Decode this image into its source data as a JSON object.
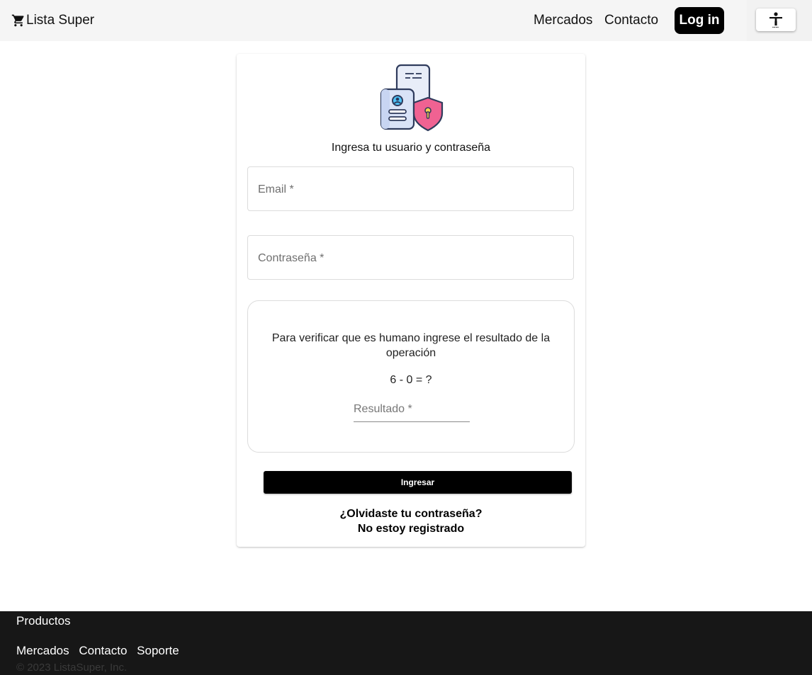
{
  "header": {
    "brand_label": "Lista Super",
    "brand_icon": "cart-icon",
    "nav": {
      "mercados": "Mercados",
      "contacto": "Contacto"
    },
    "login_label": "Log in",
    "accessibility_icon": "accessibility-icon"
  },
  "login_card": {
    "hero_icon": "secure-document-icon",
    "subtitle": "Ingresa tu usuario y contraseña",
    "email_placeholder": "Email *",
    "email_value": "",
    "password_placeholder": "Contraseña *",
    "password_value": "",
    "captcha": {
      "instruction": "Para verificar que es humano ingrese el resultado de la operación",
      "operation": "6 - 0 = ?",
      "result_placeholder": "Resultado *",
      "result_value": ""
    },
    "submit_label": "Ingresar",
    "forgot_password": "¿Olvidaste tu contraseña?",
    "not_registered": "No estoy registrado"
  },
  "footer": {
    "title": "Productos",
    "links": {
      "mercados": "Mercados",
      "contacto": "Contacto",
      "soporte": "Soporte"
    },
    "copyright": "© 2023 ListaSuper, Inc."
  },
  "colors": {
    "header_bg": "#f5f5f5",
    "primary_button": "#000000",
    "footer_bg": "#171717",
    "shield_pink": "#f06292"
  }
}
